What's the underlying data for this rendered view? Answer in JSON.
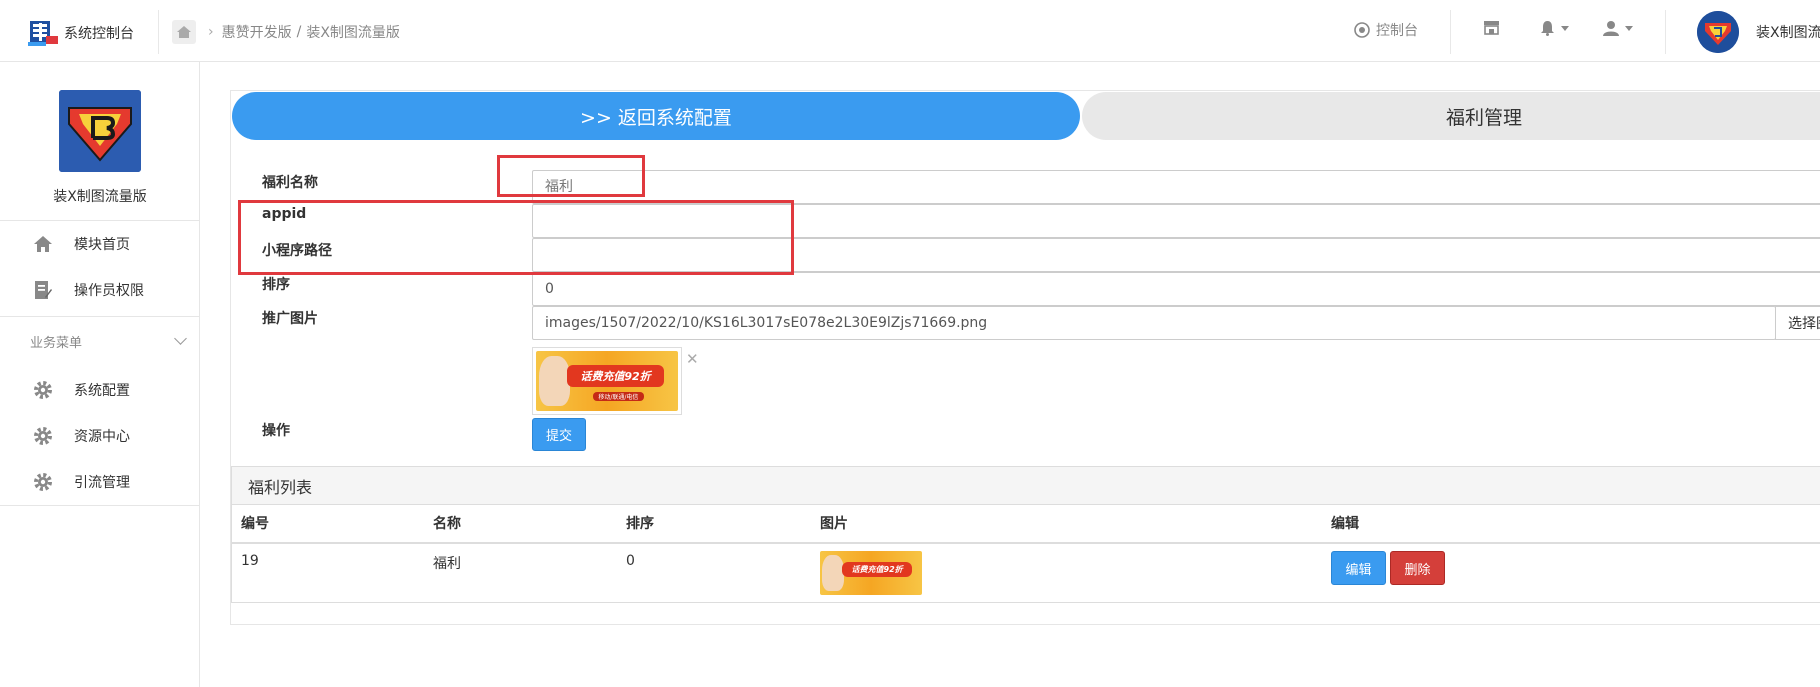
{
  "header": {
    "brand_title": "系统控制台",
    "breadcrumb": [
      "惠赞开发版",
      "装X制图流量版"
    ],
    "console_label": "控制台",
    "user_name": "装X制图流"
  },
  "sidebar": {
    "app_name": "装X制图流量版",
    "top_items": [
      {
        "label": "模块首页",
        "icon": "home-icon"
      },
      {
        "label": "操作员权限",
        "icon": "edit-doc-icon"
      }
    ],
    "group_label": "业务菜单",
    "group_items": [
      {
        "label": "系统配置",
        "icon": "gear-icon"
      },
      {
        "label": "资源中心",
        "icon": "gear-icon"
      },
      {
        "label": "引流管理",
        "icon": "gear-icon"
      }
    ]
  },
  "tabs": {
    "back_label": ">> 返回系统配置",
    "active_label": "福利管理"
  },
  "form": {
    "name_label": "福利名称",
    "name_placeholder": "福利",
    "appid_label": "appid",
    "appid_value": "",
    "path_label": "小程序路径",
    "path_value": "",
    "sort_label": "排序",
    "sort_value": "0",
    "image_label": "推广图片",
    "image_value": "images/1507/2022/10/KS16L3017sE078e2L30E9lZjs71669.png",
    "select_image_label": "选择图",
    "preview_text": "话费充值92折",
    "preview_sub": "移动/联通/电信",
    "op_label": "操作",
    "submit_label": "提交"
  },
  "list": {
    "title": "福利列表",
    "columns": [
      "编号",
      "名称",
      "排序",
      "图片",
      "编辑"
    ],
    "rows": [
      {
        "id": "19",
        "name": "福利",
        "sort": "0",
        "edit_label": "编辑",
        "delete_label": "删除"
      }
    ]
  },
  "colors": {
    "primary": "#3a9bf0",
    "danger": "#d43f3a",
    "annotation": "#e0393e"
  }
}
